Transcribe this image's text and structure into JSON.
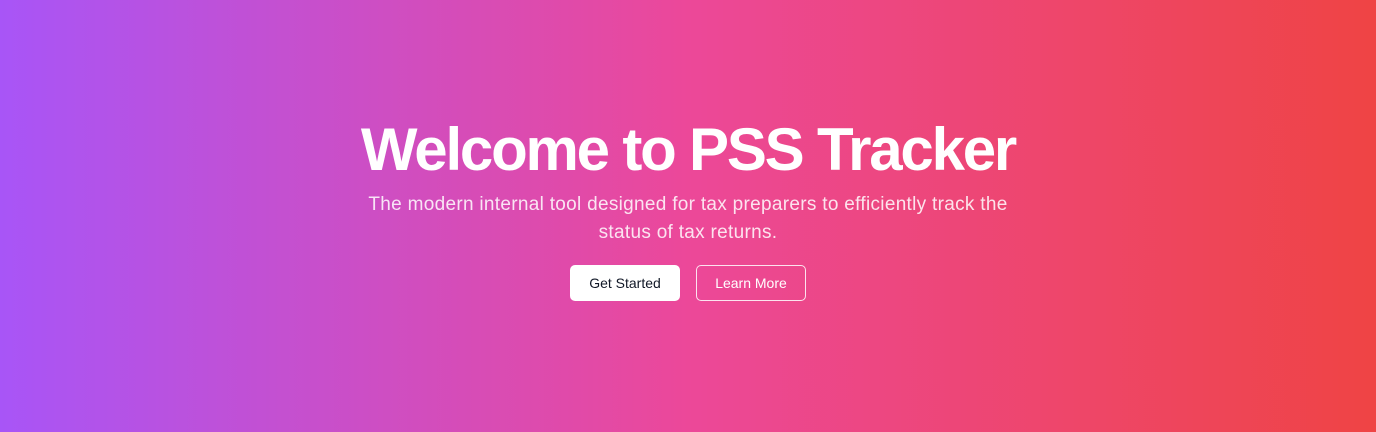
{
  "hero": {
    "title": "Welcome to PSS Tracker",
    "subtitle": "The modern internal tool designed for tax preparers to efficiently track the status of tax returns.",
    "primary_button": "Get Started",
    "secondary_button": "Learn More"
  },
  "colors": {
    "gradient_start": "#a855f7",
    "gradient_mid": "#ec4899",
    "gradient_end": "#ef4444"
  }
}
